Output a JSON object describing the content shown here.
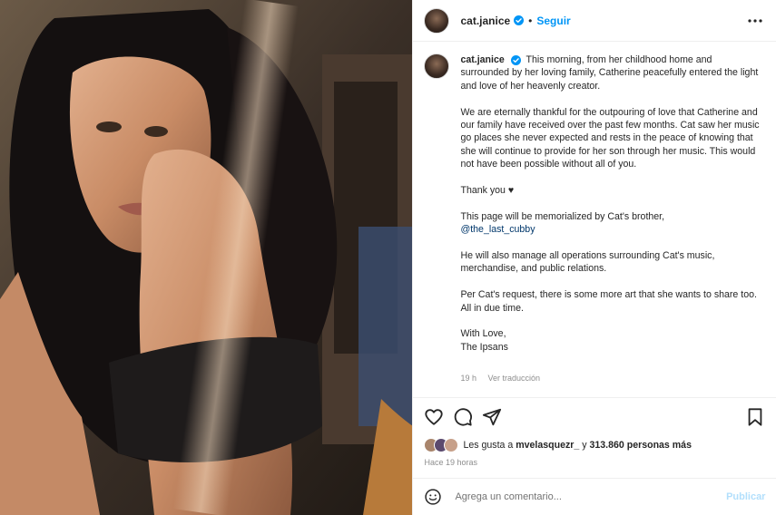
{
  "post": {
    "photo_alt": "Photo of a woman with long dark hair in sunlight",
    "author": {
      "username": "cat.janice",
      "verified": true,
      "follow_label": "Seguir"
    },
    "caption": {
      "username": "cat.janice",
      "paragraphs": [
        "This morning, from her childhood home and surrounded by her loving family, Catherine peacefully entered the light and love of her heavenly creator.",
        "We are eternally thankful for the outpouring of love that Catherine and our family have received over the past few months. Cat saw her music go places she never expected and rests in the peace of knowing that she will continue to provide for her son through her music. This would not have been possible without all of you.",
        "Thank you ♥",
        "This page will be memorialized by Cat's brother,",
        "He will also manage all operations surrounding Cat's music, merchandise, and public relations.",
        "Per Cat's request, there is some more art that she wants to share too. All in due time.",
        "With Love,",
        "The Ipsans"
      ],
      "mention": "@the_last_cubby",
      "age": "19 h",
      "translate_label": "Ver traducción"
    },
    "likes": {
      "prefix": "Les gusta a",
      "user": "mvelasquezr_",
      "middle": "y",
      "count": "313.860 personas más"
    },
    "timestamp": "Hace 19 horas",
    "comment": {
      "placeholder": "Agrega un comentario...",
      "publish_label": "Publicar"
    }
  },
  "colors": {
    "accent": "#0095f6",
    "mention": "#00376b",
    "muted": "#8e8e8e",
    "publish_disabled": "#b2dffc"
  },
  "icons": [
    "more-icon",
    "verified-icon",
    "heart-icon",
    "comment-icon",
    "share-icon",
    "bookmark-icon",
    "emoji-icon"
  ]
}
